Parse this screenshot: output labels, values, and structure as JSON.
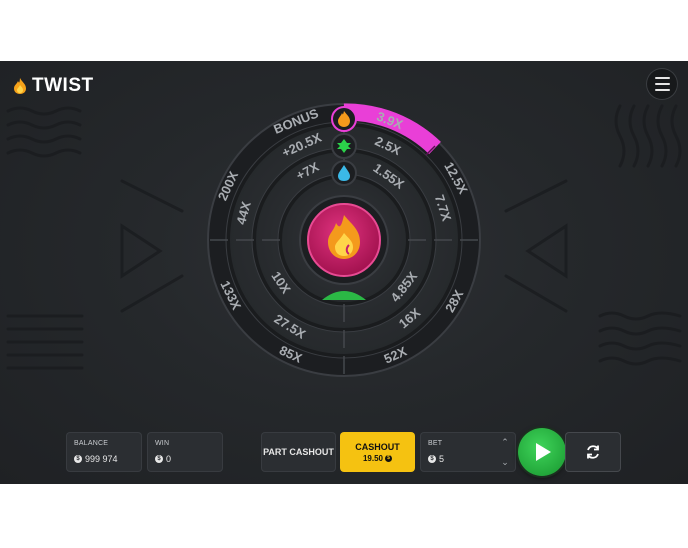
{
  "app": {
    "logo_text": "TWIST"
  },
  "wheel": {
    "bonus_label": "BONUS",
    "outer_ring": [
      "3.9X",
      "12.5X",
      "28X",
      "52X",
      "85X",
      "133X",
      "200X"
    ],
    "middle_ring": [
      "+20.5X",
      "2.5X",
      "7.7X",
      "16X",
      "27.5X",
      "44X"
    ],
    "inner_ring": [
      "+7X",
      "1.55X",
      "4.85X",
      "10X"
    ],
    "highlight_color": "#e93fd7",
    "center_color": "#c81d6b"
  },
  "balance": {
    "label": "BALANCE",
    "value": "999 974",
    "currency_symbol": "$"
  },
  "win": {
    "label": "WIN",
    "value": "0",
    "currency_symbol": "$"
  },
  "part_cashout": {
    "label": "PART CASHOUT"
  },
  "cashout": {
    "label": "CASHOUT",
    "value": "19.50",
    "currency_symbol": "$",
    "color": "#f5c211"
  },
  "bet": {
    "label": "BET",
    "value": "5",
    "currency_symbol": "$"
  },
  "play_button": {
    "color": "#2bb845"
  }
}
